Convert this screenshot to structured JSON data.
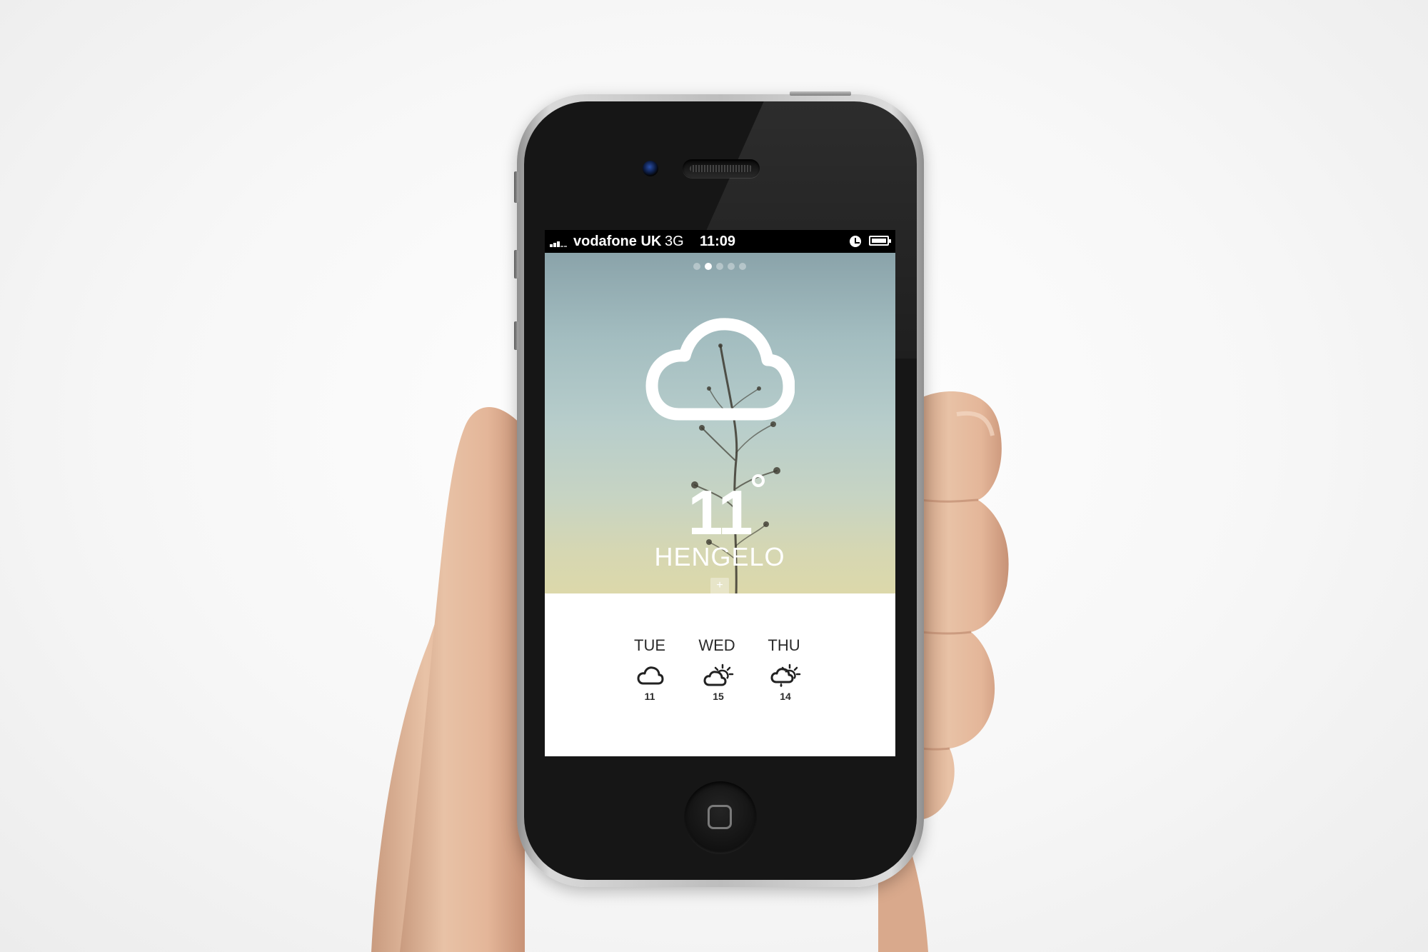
{
  "status_bar": {
    "carrier": "vodafone UK",
    "network": "3G",
    "time": "11:09",
    "icons": [
      "signal-icon",
      "clock-icon",
      "battery-icon"
    ]
  },
  "weather": {
    "condition_icon": "cloud-icon",
    "temperature": "11",
    "degree_symbol_icon": "degree-icon",
    "city": "HENGELO",
    "add_label": "+",
    "page_count": 5,
    "active_page": 2
  },
  "forecast": [
    {
      "day": "TUE",
      "icon": "cloud-icon",
      "temp": "11"
    },
    {
      "day": "WED",
      "icon": "partly-sunny-icon",
      "temp": "15"
    },
    {
      "day": "THU",
      "icon": "sun-rain-icon",
      "temp": "14"
    }
  ],
  "colors": {
    "sky_top": "#8aa3aa",
    "sky_bottom": "#dcd8aa",
    "status_bar": "#000000",
    "phone_body": "#161616"
  }
}
